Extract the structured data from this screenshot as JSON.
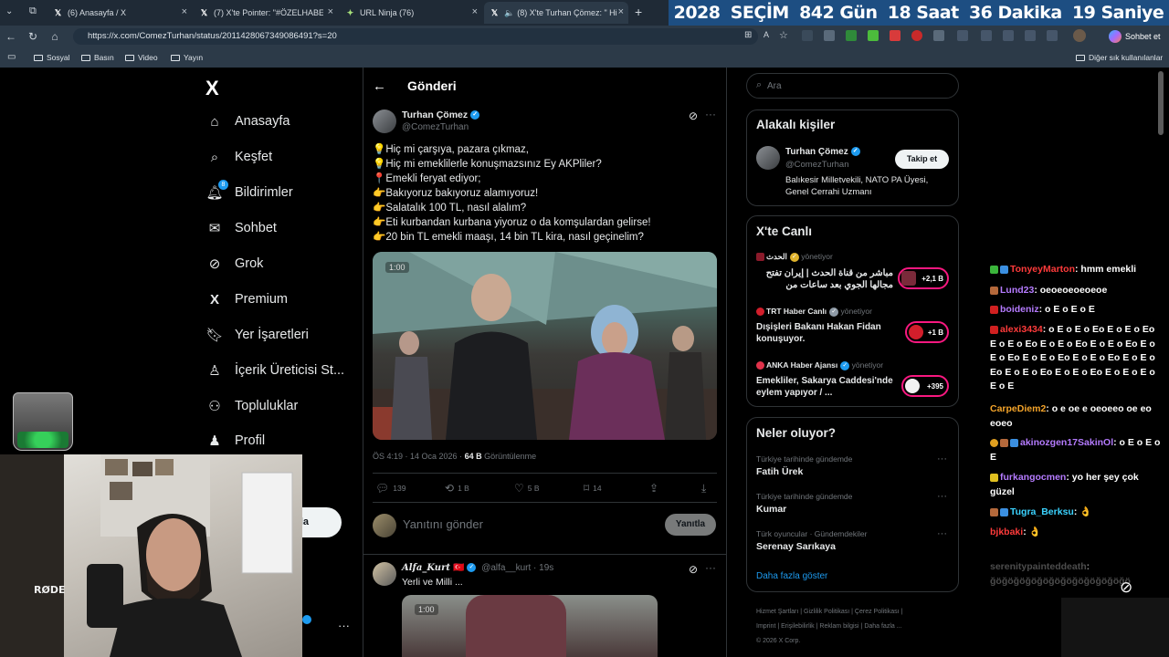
{
  "browser": {
    "tabs": [
      {
        "label": "(6) Anasayfa / X"
      },
      {
        "label": "(7) X'te Pointer: \"#ÖZELHABER De...\""
      },
      {
        "label": "URL Ninja (76)"
      },
      {
        "label": "(8) X'te Turhan Çömez: \" Hi..."
      }
    ],
    "banner": [
      "2028",
      "SEÇİM",
      "842 Gün",
      "18 Saat",
      "36 Dakika",
      "19 Saniye"
    ],
    "url": "https://x.com/ComezTurhan/status/2011428067349086491?s=20",
    "chat_button": "Sohbet et",
    "favorites": [
      "Sosyal",
      "Basın",
      "Video",
      "Yayın"
    ],
    "other_favorites": "Diğer sık kullanılanlar"
  },
  "sidebar": {
    "logo": "X",
    "items": [
      "Anasayfa",
      "Keşfet",
      "Bildirimler",
      "Sohbet",
      "Grok",
      "Premium",
      "Yer İşaretleri",
      "İçerik Üreticisi St...",
      "Topluluklar",
      "Profil"
    ],
    "notif_count": "8",
    "post_button": "la"
  },
  "post": {
    "header": "Gönderi",
    "author": "Turhan Çömez",
    "handle": "@ComezTurhan",
    "lines": [
      "💡Hiç mi çarşıya, pazara çıkmaz,",
      "💡Hiç mi emeklilerle konuşmazsınız Ey AKPliler?",
      "📍Emekli feryat ediyor;",
      "👉Bakıyoruz bakıyoruz alamıyoruz!",
      "👉Salatalık 100 TL, nasıl alalım?",
      "👉Eti kurbandan kurbana yiyoruz o da komşulardan gelirse!",
      "👉20 bin TL emekli maaşı, 14 bin TL kira, nasıl geçinelim?"
    ],
    "video_time": "1:00",
    "meta_time": "ÖS 4:19 · 14 Oca 2026 · ",
    "views": "64 B",
    "views_label": "Görüntülenme",
    "stats": {
      "replies": "139",
      "reposts": "1 B",
      "likes": "5 B",
      "bookmarks": "14"
    },
    "reply_placeholder": "Yanıtını gönder",
    "reply_button": "Yanıtla"
  },
  "reply": {
    "author": "Alfa_Kurt",
    "handle": "@alfa__kurt",
    "age": "19s",
    "text": "Yerli ve Milli ...",
    "video_time": "1:00"
  },
  "right": {
    "search_placeholder": "Ara",
    "related_title": "Alakalı kişiler",
    "related": {
      "name": "Turhan Çömez",
      "handle": "@ComezTurhan",
      "bio": "Balıkesir Milletvekili, NATO PA Üyesi, Genel Cerrahi Uzmanı",
      "follow": "Takip et"
    },
    "live_title": "X'te Canlı",
    "live": [
      {
        "host": "الحدث",
        "role": "yönetiyor",
        "title": "مباشر من قناة الحدث | إيران تفتح مجالها الجوي بعد ساعات من",
        "count": "+2,1 B"
      },
      {
        "host": "TRT Haber Canlı",
        "role": "yönetiyor",
        "title": "Dışişleri Bakanı Hakan Fidan konuşuyor.",
        "count": "+1 B"
      },
      {
        "host": "ANKA Haber Ajansı",
        "role": "yönetiyor",
        "title": "Emekliler, Sakarya Caddesi'nde eylem yapıyor / ...",
        "count": "+395"
      }
    ],
    "trends_title": "Neler oluyor?",
    "trends": [
      {
        "context": "Türkiye tarihinde gündemde",
        "name": "Fatih Ürek"
      },
      {
        "context": "Türkiye tarihinde gündemde",
        "name": "Kumar"
      },
      {
        "context": "Türk oyuncular · Gündemdekiler",
        "name": "Serenay Sarıkaya"
      }
    ],
    "show_more": "Daha fazla göster",
    "footer": [
      "Hizmet Şartları",
      "Gizlilik Politikası",
      "Çerez Politikası",
      "Imprint",
      "Erişilebilirlik",
      "Reklam bilgisi",
      "Daha fazla ...",
      "© 2026 X Corp."
    ]
  },
  "chat": [
    {
      "user": "TonyeyMarton",
      "color": "#ff3b3b",
      "msg": "hmm emekli"
    },
    {
      "user": "Lund23",
      "color": "#b57bff",
      "msg": "oeoeoeoeoeoe"
    },
    {
      "user": "boideniz",
      "color": "#b57bff",
      "msg": "o E o E o E"
    },
    {
      "user": "alexi3434",
      "color": "#ff3b3b",
      "msg": "o E o E o Eo E o E o Eo E o E o Eo E o E o Eo E o E o Eo E o E o Eo E o E o Eo E o E o Eo E o E o Eo E o E o Eo E o E o Eo E o E o E o E o E"
    },
    {
      "user": "CarpeDiem2",
      "color": "#f4a42a",
      "msg": "o e oe e oeoeeo oe eo eoeo"
    },
    {
      "user": "akinozgen17SakinOl",
      "color": "#b57bff",
      "msg": "o E o E o E"
    },
    {
      "user": "furkangocmen",
      "color": "#b57bff",
      "msg": "yo her şey çok güzel"
    },
    {
      "user": "Tugra_Berksu",
      "color": "#3bd3ff",
      "msg": "👌"
    },
    {
      "user": "bjkbaki",
      "color": "#ff3b3b",
      "msg": "👌"
    },
    {
      "user": "serenitypainteddeath",
      "color": "#8a8a8a",
      "msg": "ğöğöğöğöğöğöğöğöğöğöğöğö"
    }
  ],
  "cam": {
    "mic_label": "RØDE"
  }
}
